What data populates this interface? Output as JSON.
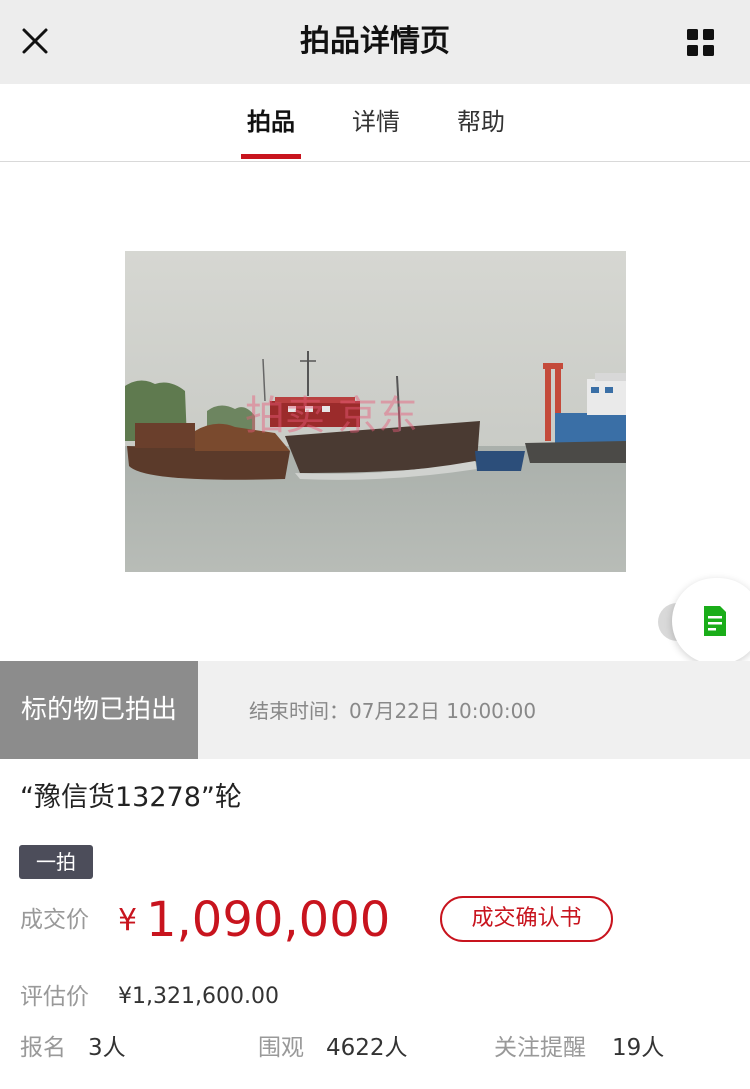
{
  "header": {
    "title": "拍品详情页",
    "close_icon": "close-icon",
    "menu_icon": "grid-icon"
  },
  "tabs": [
    {
      "label": "拍品",
      "active": true
    },
    {
      "label": "详情",
      "active": false
    },
    {
      "label": "帮助",
      "active": false
    }
  ],
  "photo": {
    "watermark": "拍卖 京东"
  },
  "status": {
    "sold_text": "标的物已拍出",
    "end_time": "结束时间：07月22日 10:00:00"
  },
  "item": {
    "title": "“豫信货13278”轮",
    "round_badge": "一拍"
  },
  "price": {
    "deal_label": "成交价",
    "currency": "¥",
    "deal_amount": "1,090,000",
    "confirm_button": "成交确认书",
    "appraisal_label": "评估价",
    "appraisal_value": "¥1,321,600.00"
  },
  "stats": [
    {
      "label": "报名",
      "value": "3人"
    },
    {
      "label": "围观",
      "value": "4622人"
    },
    {
      "label": "关注提醒",
      "value": "19人"
    }
  ],
  "colors": {
    "accent": "#c8141e",
    "header_bg": "#ededed",
    "sold_bg": "#8c8c8c",
    "badge_bg": "#4c4d5a",
    "doc_icon": "#1aad19"
  }
}
